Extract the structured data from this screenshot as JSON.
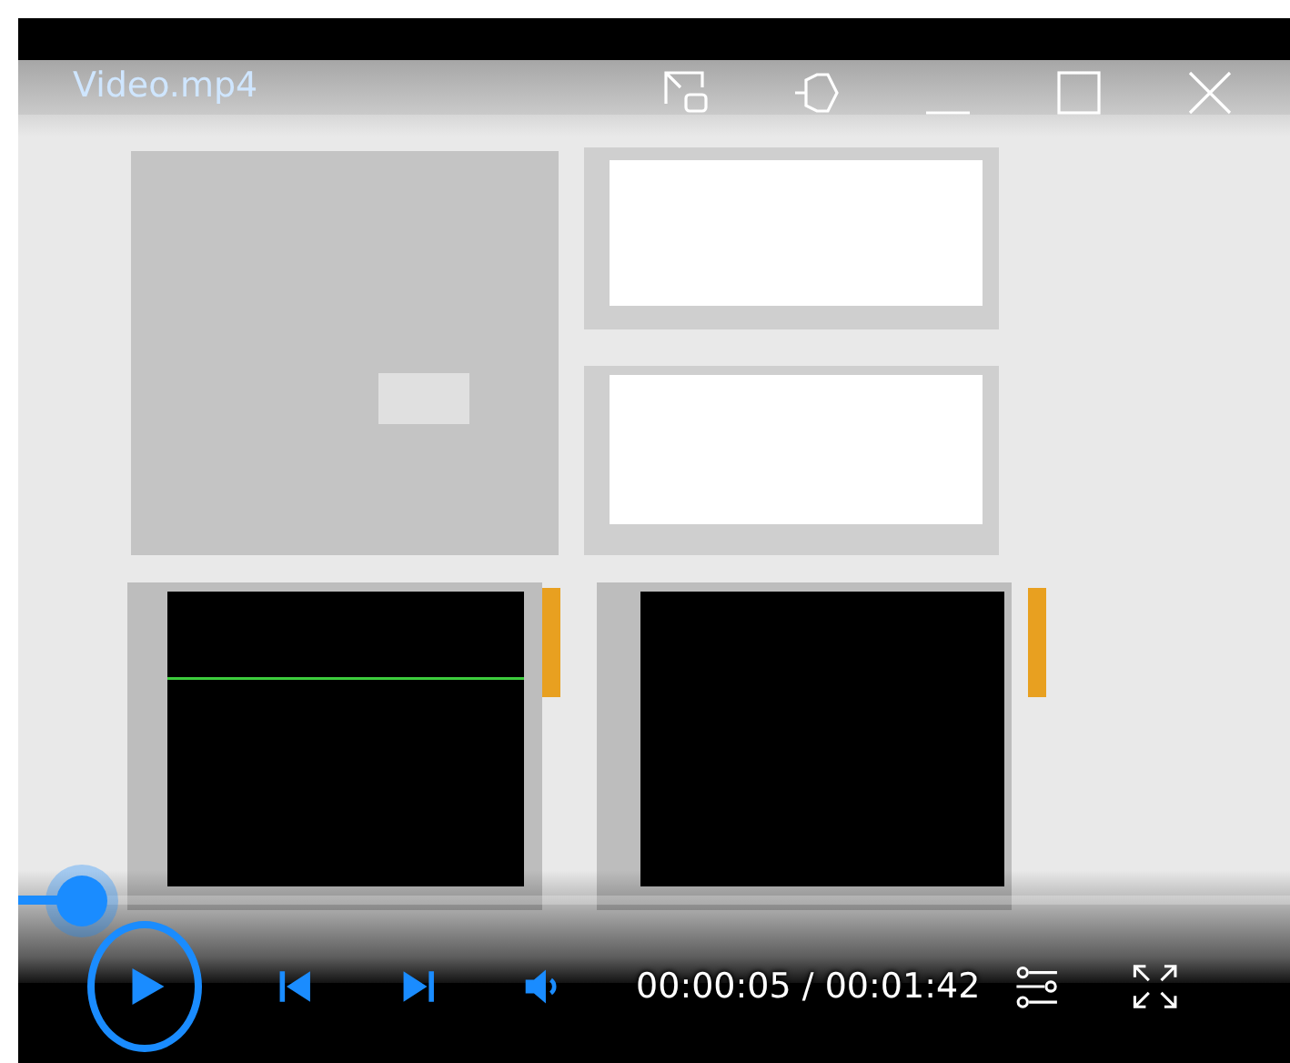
{
  "window": {
    "title": "Video.mp4"
  },
  "seek_bar": {
    "level": 0.05
  },
  "player": {
    "playing": false,
    "time": "00:00:05 / 00:01:42"
  }
}
